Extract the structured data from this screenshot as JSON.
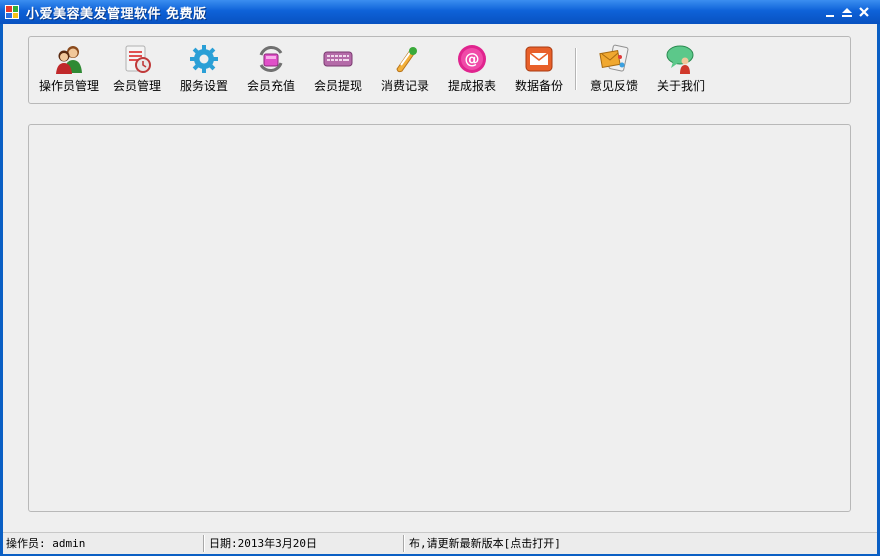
{
  "window": {
    "title": "小爱美容美发管理软件 免费版",
    "controls": [
      "minimize",
      "restore",
      "close"
    ]
  },
  "toolbar": {
    "items": [
      {
        "label": "操作员管理",
        "icon": "users-icon"
      },
      {
        "label": "会员管理",
        "icon": "member-card-icon"
      },
      {
        "label": "服务设置",
        "icon": "gear-icon"
      },
      {
        "label": "会员充值",
        "icon": "recharge-icon"
      },
      {
        "label": "会员提现",
        "icon": "keyboard-icon"
      },
      {
        "label": "消费记录",
        "icon": "scroll-icon"
      },
      {
        "label": "提成报表",
        "icon": "at-icon"
      },
      {
        "label": "数据备份",
        "icon": "envelope-icon"
      },
      {
        "label": "意见反馈",
        "icon": "feedback-mail-icon"
      },
      {
        "label": "关于我们",
        "icon": "chat-person-icon"
      }
    ]
  },
  "statusbar": {
    "operator": "操作员: admin",
    "date": "日期:2013年3月20日",
    "notice": "布,请更新最新版本[点击打开]"
  },
  "colors": {
    "titlebar": "#0e62d8",
    "client": "#efefef"
  }
}
